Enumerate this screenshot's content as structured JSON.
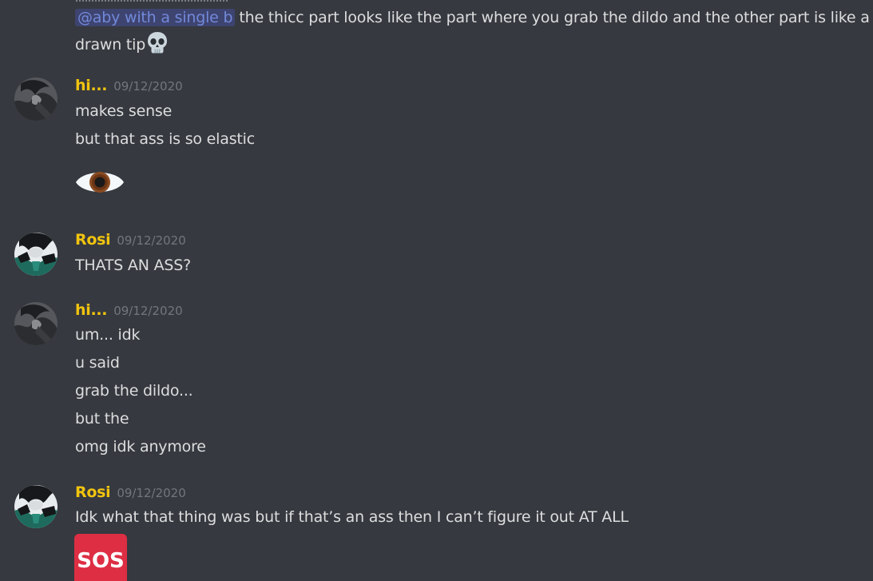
{
  "top_message": {
    "mention": "@aby with a single b",
    "line1": "the thicc part looks like the part where you grab the dildo and the other part is like a non",
    "line2": "drawn tip"
  },
  "groups": [
    {
      "username": "hi...",
      "timestamp": "09/12/2020",
      "lines": [
        "makes sense",
        "but that ass is so elastic"
      ],
      "emoji": "eye-icon"
    },
    {
      "username": "Rosi",
      "timestamp": "09/12/2020",
      "lines": [
        "THATS AN ASS?"
      ]
    },
    {
      "username": "hi...",
      "timestamp": "09/12/2020",
      "lines": [
        "um... idk",
        "u said",
        "grab the dildo...",
        "but the",
        "omg idk anymore"
      ]
    },
    {
      "username": "Rosi",
      "timestamp": "09/12/2020",
      "lines": [
        "Idk what that thing was but if that’s an ass then I can’t figure it out AT ALL"
      ],
      "emoji": "sos-icon",
      "emoji_text": "SOS"
    }
  ],
  "colors": {
    "background": "#36393f",
    "message_text": "#dcddde",
    "username": "#f1c40f",
    "timestamp": "#72767d",
    "mention_text": "#7289da",
    "mention_bg": "#3e4470",
    "sos_red": "#dd2e44"
  }
}
